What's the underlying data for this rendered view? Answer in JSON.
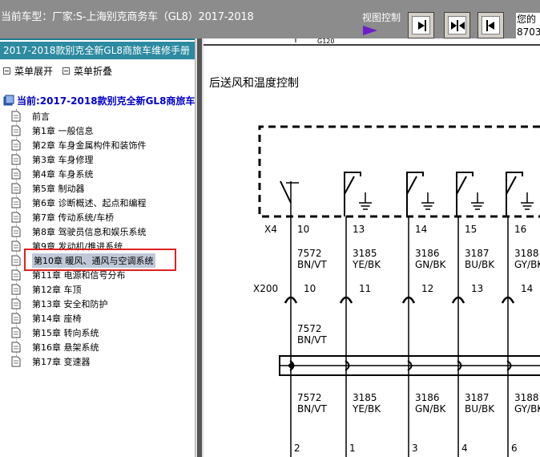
{
  "topbar": {
    "vehicle_title": "当前车型：厂家:S-上海别克商务车（GL8）2017-2018",
    "view_control_label": "视图控制",
    "buttons": [
      "expand-right",
      "split",
      "collapse-left"
    ],
    "greeting_line1": "您的",
    "greeting_line2": "8703"
  },
  "sidebar": {
    "manual_title": "2017-2018款别克全新GL8商旅车维修手册",
    "expand_menu": "菜单展开",
    "collapse_menu": "菜单折叠",
    "current_label": "当前:2017-2018款别克全新GL8商旅车维修",
    "items": [
      {
        "label": "前言"
      },
      {
        "label": "第1章 一般信息"
      },
      {
        "label": "第2章 车身金属构件和装饰件"
      },
      {
        "label": "第3章 车身修理"
      },
      {
        "label": "第4章 车身系统"
      },
      {
        "label": "第5章 制动器"
      },
      {
        "label": "第6章 诊断概述、起点和编程"
      },
      {
        "label": "第7章 传动系统/车桥"
      },
      {
        "label": "第8章 驾驶员信息和娱乐系统"
      },
      {
        "label": "第9章 发动机/推进系统"
      },
      {
        "label": "第10章 暖风、通风与空调系统"
      },
      {
        "label": "第11章 电源和信号分布"
      },
      {
        "label": "第12章 车顶"
      },
      {
        "label": "第13章 安全和防护"
      },
      {
        "label": "第14章 座椅"
      },
      {
        "label": "第15章 转向系统"
      },
      {
        "label": "第16章 悬架系统"
      },
      {
        "label": "第17章 变速器"
      }
    ],
    "selected_index": 10
  },
  "main": {
    "top_fragment": "G120",
    "section_title": "后送风和温度控制",
    "x4_label": "X4",
    "x200_label": "X200",
    "x4_pins": [
      "10",
      "13",
      "14",
      "15",
      "16"
    ],
    "x200_pins": [
      "10",
      "11",
      "12",
      "13",
      "14"
    ],
    "bottom_pins": [
      "2",
      "1",
      "3",
      "4",
      "6"
    ],
    "circuits": [
      {
        "num": "7572",
        "color": "BN/VT"
      },
      {
        "num": "3185",
        "color": "YE/BK"
      },
      {
        "num": "3186",
        "color": "GN/BK"
      },
      {
        "num": "3187",
        "color": "BU/BK"
      },
      {
        "num": "3188",
        "color": "GY/BK"
      }
    ]
  }
}
